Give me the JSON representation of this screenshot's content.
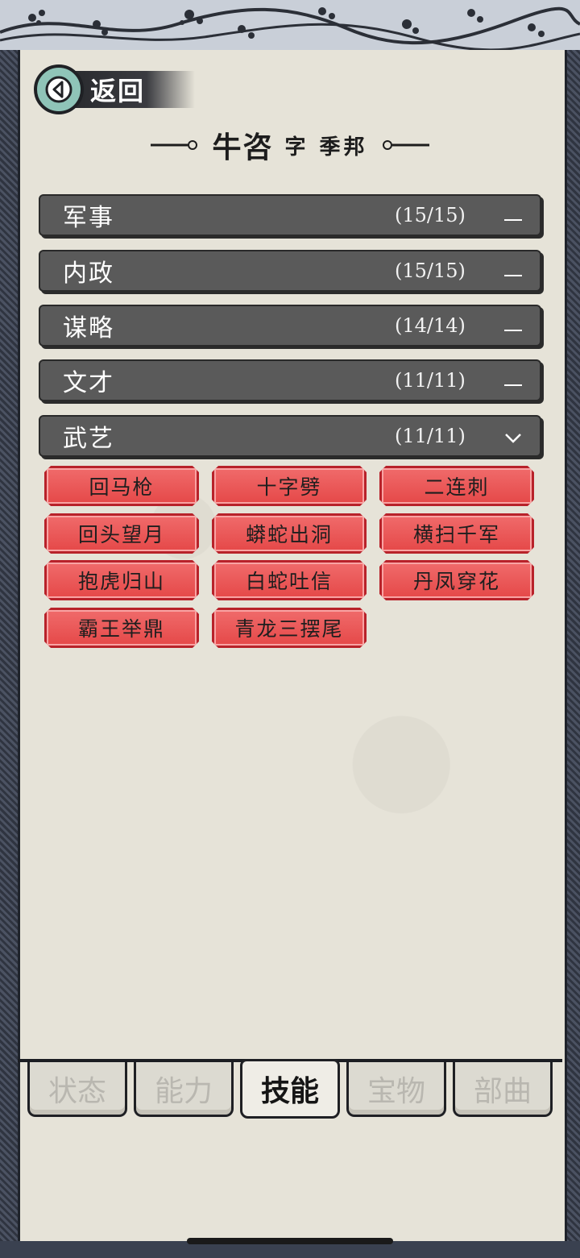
{
  "header": {
    "back_label": "返回",
    "back_icon": "chevron-left-icon"
  },
  "title": {
    "name": "牛咨",
    "courtesy": "字 季邦"
  },
  "categories": [
    {
      "name": "军事",
      "count": "(15/15)",
      "state": "collapsed"
    },
    {
      "name": "内政",
      "count": "(15/15)",
      "state": "collapsed"
    },
    {
      "name": "谋略",
      "count": "(14/14)",
      "state": "collapsed"
    },
    {
      "name": "文才",
      "count": "(11/11)",
      "state": "collapsed"
    },
    {
      "name": "武艺",
      "count": "(11/11)",
      "state": "expanded"
    }
  ],
  "skills": [
    "回马枪",
    "十字劈",
    "二连刺",
    "回头望月",
    "蟒蛇出洞",
    "横扫千军",
    "抱虎归山",
    "白蛇吐信",
    "丹凤穿花",
    "霸王举鼎",
    "青龙三摆尾"
  ],
  "tabs": [
    {
      "label": "状态",
      "active": false
    },
    {
      "label": "能力",
      "active": false
    },
    {
      "label": "技能",
      "active": true
    },
    {
      "label": "宝物",
      "active": false
    },
    {
      "label": "部曲",
      "active": false
    }
  ],
  "colors": {
    "skill_red": "#e54848",
    "category_gray": "#5a5a5a",
    "back_teal": "#8fc4b8",
    "parchment": "#e6e3d8"
  }
}
